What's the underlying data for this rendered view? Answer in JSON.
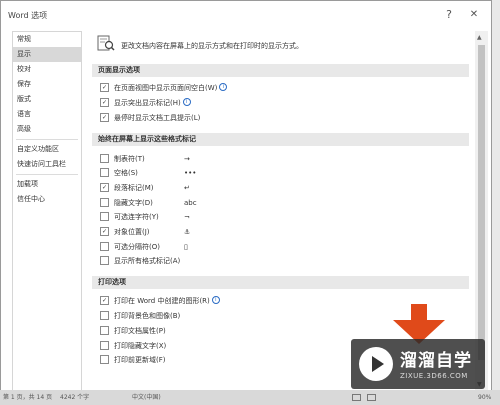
{
  "window": {
    "title": "Word 选项",
    "help": "?",
    "close": "✕"
  },
  "sidebar": {
    "items": [
      {
        "label": "常规"
      },
      {
        "label": "显示"
      },
      {
        "label": "校对"
      },
      {
        "label": "保存"
      },
      {
        "label": "版式"
      },
      {
        "label": "语言"
      },
      {
        "label": "高级"
      },
      {
        "label": "自定义功能区"
      },
      {
        "label": "快速访问工具栏"
      },
      {
        "label": "加载项"
      },
      {
        "label": "信任中心"
      }
    ],
    "active_index": 1
  },
  "header": {
    "text": "更改文档内容在屏幕上的显示方式和在打印时的显示方式。"
  },
  "sections": {
    "page_display": {
      "title": "页面显示选项",
      "options": [
        {
          "label": "在页面视图中显示页面间空白(W)",
          "checked": true,
          "info": true
        },
        {
          "label": "显示突出显示标记(H)",
          "checked": true,
          "info": true
        },
        {
          "label": "悬停时显示文档工具提示(L)",
          "checked": true,
          "info": false
        }
      ]
    },
    "format_marks": {
      "title": "始终在屏幕上显示这些格式标记",
      "options": [
        {
          "label": "制表符(T)",
          "checked": false,
          "symbol": "→"
        },
        {
          "label": "空格(S)",
          "checked": false,
          "symbol": "•••"
        },
        {
          "label": "段落标记(M)",
          "checked": true,
          "symbol": "↵"
        },
        {
          "label": "隐藏文字(D)",
          "checked": false,
          "symbol": "abc"
        },
        {
          "label": "可选连字符(Y)",
          "checked": false,
          "symbol": "¬"
        },
        {
          "label": "对象位置(J)",
          "checked": true,
          "symbol": "⚓"
        },
        {
          "label": "可选分隔符(O)",
          "checked": false,
          "symbol": "▯"
        },
        {
          "label": "显示所有格式标记(A)",
          "checked": false,
          "symbol": ""
        }
      ]
    },
    "print": {
      "title": "打印选项",
      "options": [
        {
          "label": "打印在 Word 中创建的图形(R)",
          "checked": true,
          "info": true
        },
        {
          "label": "打印背景色和图像(B)",
          "checked": false,
          "info": false
        },
        {
          "label": "打印文档属性(P)",
          "checked": false,
          "info": false
        },
        {
          "label": "打印隐藏文字(X)",
          "checked": false,
          "info": false
        },
        {
          "label": "打印前更新域(F)",
          "checked": false,
          "info": false
        }
      ]
    }
  },
  "statusbar": {
    "page": "第 1 页，共 14 页",
    "words": "4242 个字",
    "lang": "中文(中国)",
    "zoom": "90%"
  },
  "watermark": {
    "name": "溜溜自学",
    "url": "ZIXUE.3D66.COM"
  },
  "colors": {
    "accent": "#2b6cc4",
    "arrow": "#e04a1a",
    "active_item": "#d8d8d8",
    "section_bar": "#e8e8e8"
  }
}
